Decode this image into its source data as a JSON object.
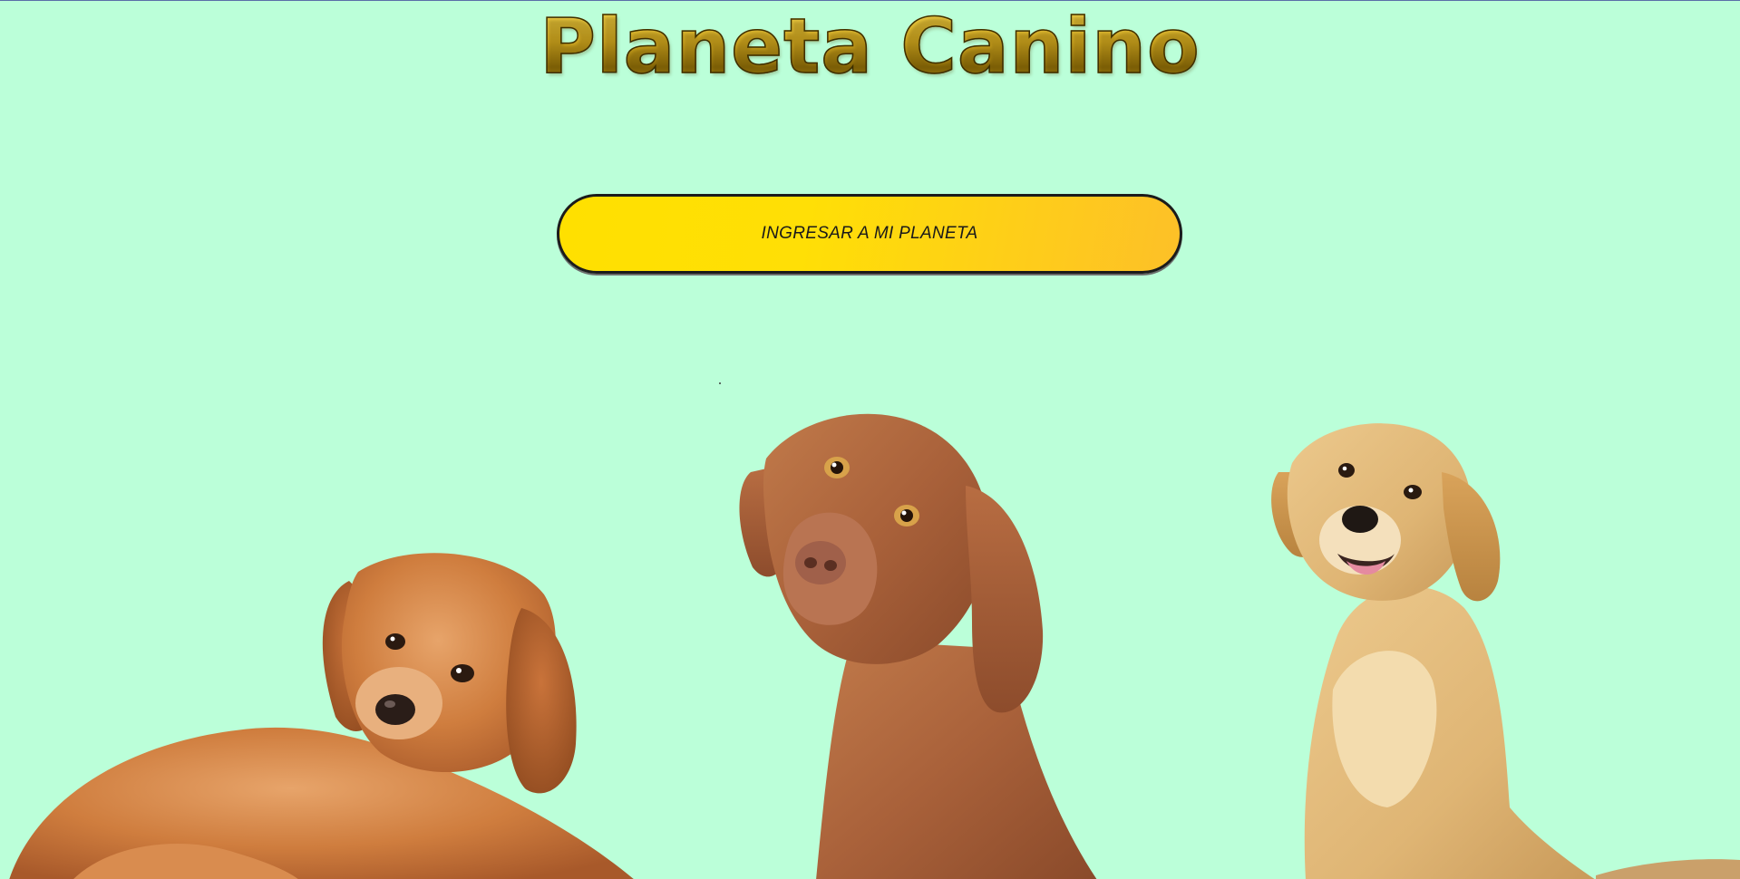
{
  "page": {
    "title": "Planeta Canino",
    "background_color": "#bbffd9",
    "accent_color": "#ffe000"
  },
  "cta": {
    "label": "INGRESAR A MI PLANETA"
  },
  "images": {
    "left_dog": "golden-puppy-lying-down",
    "center_dog": "vizsla-head-tilt",
    "right_dog": "golden-retriever-puppy-sitting"
  }
}
